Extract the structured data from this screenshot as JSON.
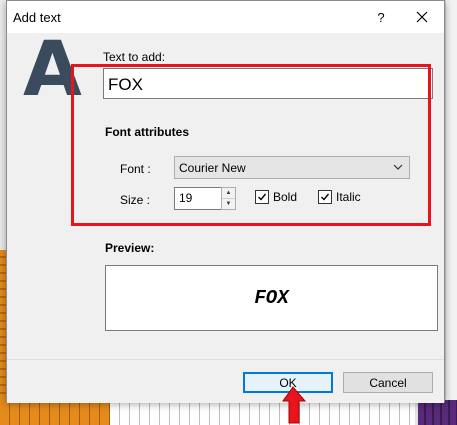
{
  "dialog": {
    "title": "Add text",
    "help_label": "?",
    "big_letter": "A",
    "text_to_add_label": "Text to add:",
    "text_value": "FOX",
    "font_attributes_title": "Font attributes",
    "font_label": "Font :",
    "font_value": "Courier New",
    "size_label": "Size :",
    "size_value": "19",
    "bold_label": "Bold",
    "bold_checked": true,
    "italic_label": "Italic",
    "italic_checked": true,
    "preview_label": "Preview:",
    "preview_text": "FOX",
    "ok_label": "OK",
    "cancel_label": "Cancel"
  },
  "colors": {
    "highlight_box": "#e8141c",
    "arrow": "#e8141c",
    "big_letter": "#3a4b5e",
    "default_button_border": "#0078d7"
  },
  "icons": [
    "close-icon",
    "chevron-down-icon",
    "spin-up-icon",
    "spin-down-icon",
    "checkmark-icon",
    "red-arrow-icon"
  ]
}
